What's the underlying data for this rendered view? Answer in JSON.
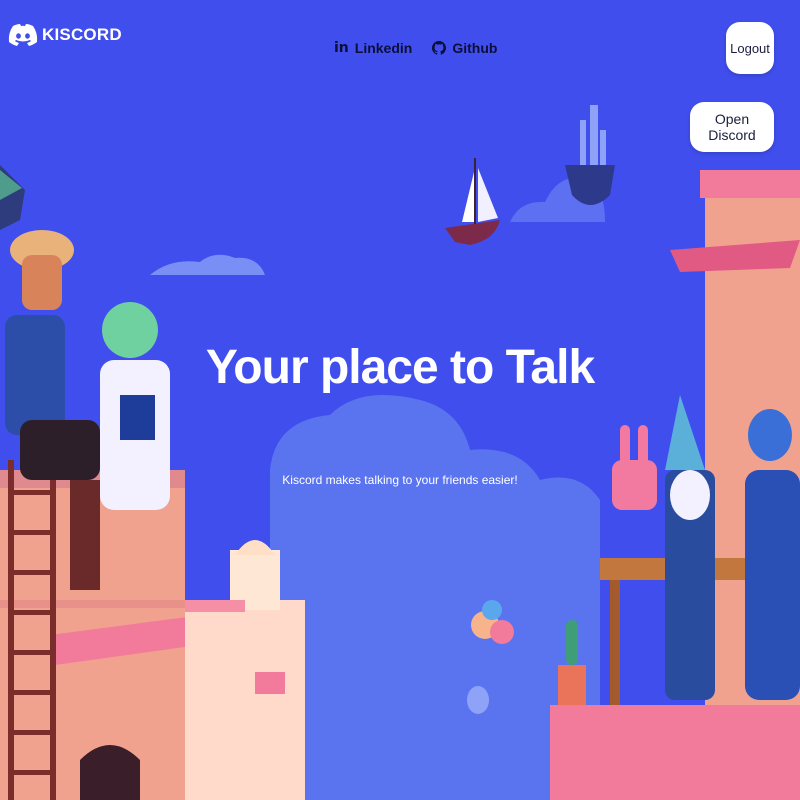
{
  "brand": {
    "name": "KISCORD"
  },
  "nav": {
    "linkedin": {
      "icon": "linkedin-icon",
      "label": "Linkedin"
    },
    "github": {
      "icon": "github-icon",
      "label": "Github"
    }
  },
  "auth": {
    "logout_label": "Logout",
    "open_label": "Open Discord"
  },
  "hero": {
    "title": "Your place to Talk",
    "subtitle": "Kiscord makes talking to your friends easier!"
  },
  "colors": {
    "background": "#404eed",
    "accent_pink": "#f27a9b",
    "text": "#ffffff"
  }
}
